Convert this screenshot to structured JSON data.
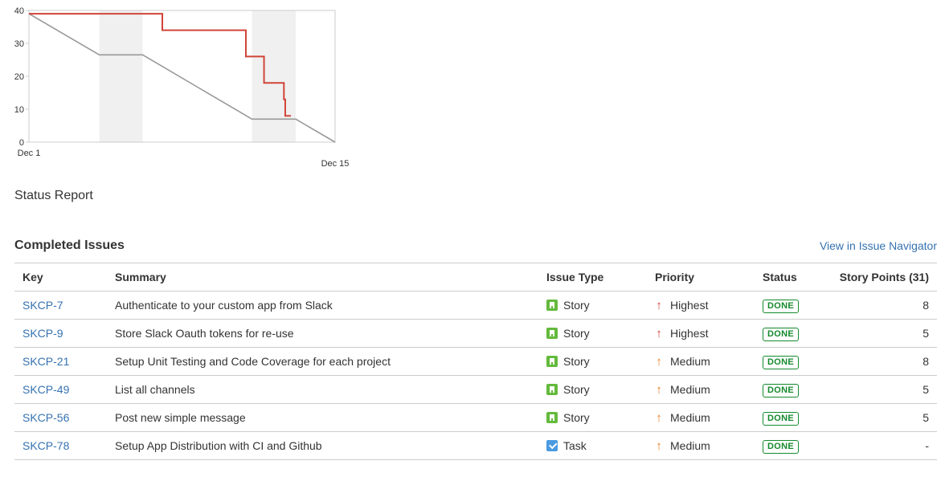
{
  "chart_data": {
    "type": "line",
    "ylim": [
      0,
      40
    ],
    "y_ticks": [
      "0",
      "10",
      "20",
      "30",
      "40"
    ],
    "x_range_days": [
      0,
      14
    ],
    "x_tick_labels": [
      {
        "day": 0,
        "label": "Dec 1"
      },
      {
        "day": 14,
        "label": "Dec 15"
      }
    ],
    "non_working_periods": [
      [
        3.22,
        5.2
      ],
      [
        10.2,
        12.2
      ]
    ],
    "series": [
      {
        "role": "guideline",
        "color": "#999999",
        "points": [
          [
            0,
            39
          ],
          [
            3.22,
            26.5
          ],
          [
            5.2,
            26.5
          ],
          [
            10.2,
            7
          ],
          [
            12.2,
            7
          ],
          [
            14,
            0
          ]
        ]
      },
      {
        "role": "remaining",
        "color": "#d04437",
        "points": [
          [
            0,
            39
          ],
          [
            6.1,
            39
          ],
          [
            6.1,
            34
          ],
          [
            9.92,
            34
          ],
          [
            9.92,
            26
          ],
          [
            10.75,
            26
          ],
          [
            10.75,
            18
          ],
          [
            11.66,
            18
          ],
          [
            11.66,
            13
          ],
          [
            11.72,
            13
          ],
          [
            11.72,
            8
          ],
          [
            11.98,
            8
          ]
        ]
      }
    ]
  },
  "report": {
    "title": "Status Report"
  },
  "completed": {
    "title": "Completed Issues",
    "navigator_link": "View in Issue Navigator",
    "columns": {
      "key": "Key",
      "summary": "Summary",
      "type": "Issue Type",
      "priority": "Priority",
      "status": "Status",
      "points": "Story Points (31)"
    },
    "rows": [
      {
        "key": "SKCP-7",
        "summary": "Authenticate to your custom app from Slack",
        "type": "Story",
        "type_icon": "story-icon",
        "priority": "Highest",
        "priority_icon": "arrow-up-icon",
        "status": "DONE",
        "points": "8"
      },
      {
        "key": "SKCP-9",
        "summary": "Store Slack Oauth tokens for re-use",
        "type": "Story",
        "type_icon": "story-icon",
        "priority": "Highest",
        "priority_icon": "arrow-up-icon",
        "status": "DONE",
        "points": "5"
      },
      {
        "key": "SKCP-21",
        "summary": "Setup Unit Testing and Code Coverage for each project",
        "type": "Story",
        "type_icon": "story-icon",
        "priority": "Medium",
        "priority_icon": "arrow-up-icon",
        "status": "DONE",
        "points": "8"
      },
      {
        "key": "SKCP-49",
        "summary": "List all channels",
        "type": "Story",
        "type_icon": "story-icon",
        "priority": "Medium",
        "priority_icon": "arrow-up-icon",
        "status": "DONE",
        "points": "5"
      },
      {
        "key": "SKCP-56",
        "summary": "Post new simple message",
        "type": "Story",
        "type_icon": "story-icon",
        "priority": "Medium",
        "priority_icon": "arrow-up-icon",
        "status": "DONE",
        "points": "5"
      },
      {
        "key": "SKCP-78",
        "summary": "Setup App Distribution with CI and Github",
        "type": "Task",
        "type_icon": "task-icon",
        "priority": "Medium",
        "priority_icon": "arrow-up-icon",
        "status": "DONE",
        "points": "-"
      }
    ]
  },
  "colors": {
    "link": "#3572b0",
    "done": "#14892c",
    "priority_highest": "#d04437",
    "priority_medium": "#ea7d24",
    "story": "#63ba3c",
    "task": "#4a9ae1"
  }
}
